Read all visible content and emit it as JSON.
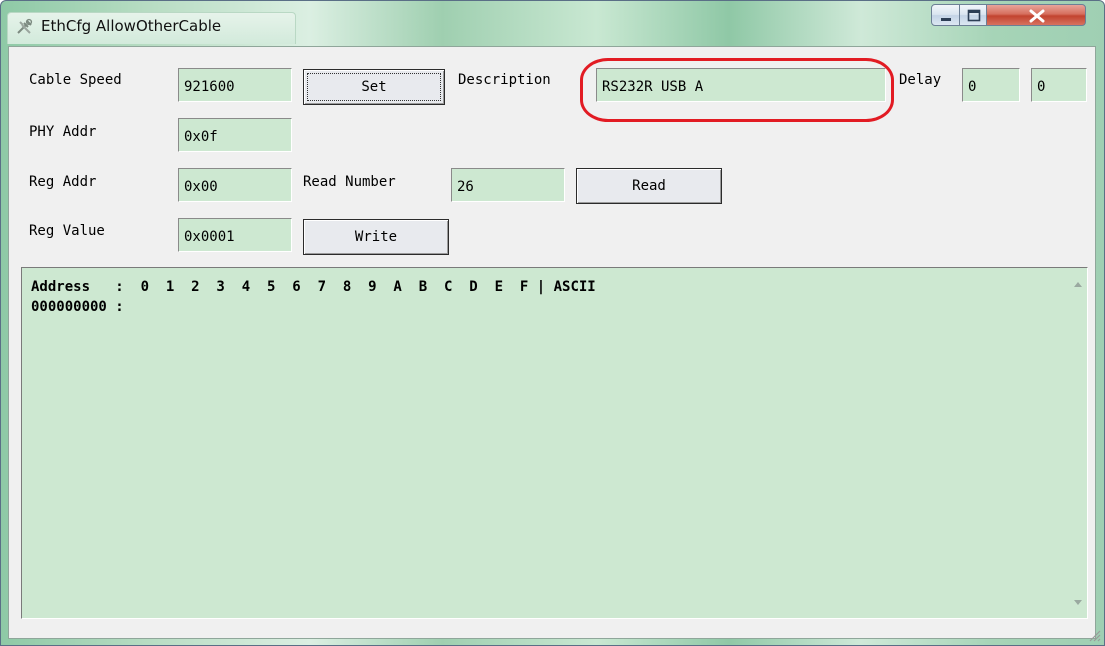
{
  "window": {
    "title": "EthCfg AllowOtherCable",
    "app_icon": "tools-icon",
    "controls": [
      "minimize-icon",
      "maximize-icon",
      "close-icon"
    ]
  },
  "config": {
    "cable_speed_label": "Cable Speed",
    "cable_speed_value": "921600",
    "set_label": "Set",
    "description_label": "Description",
    "description_value": "RS232R USB A",
    "delay_label": "Delay",
    "delay_value_1": "0",
    "delay_value_2": "0",
    "phy_addr_label": "PHY Addr",
    "phy_addr_value": "0x0f",
    "reg_addr_label": "Reg Addr",
    "reg_addr_value": "0x00",
    "read_number_label": "Read Number",
    "read_number_value": "26",
    "read_label": "Read",
    "reg_value_label": "Reg Value",
    "reg_value_value": "0x0001",
    "write_label": "Write"
  },
  "hexdump": {
    "header": "Address   :  0  1  2  3  4  5  6  7  8  9  A  B  C  D  E  F | ASCII",
    "rows": [
      "000000000 :"
    ]
  },
  "colors": {
    "field_bg": "#cde8d1",
    "dialog_bg": "#f0f0f0",
    "annotation": "#e21b23",
    "close_button": "#c2432f"
  }
}
